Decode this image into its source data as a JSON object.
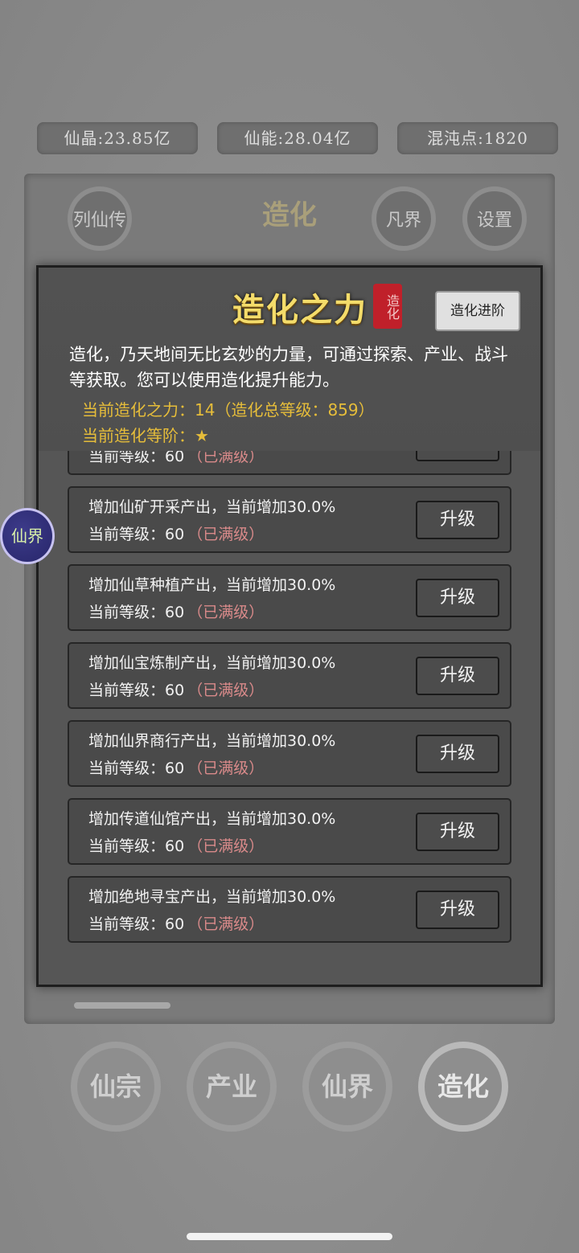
{
  "resources": [
    {
      "label": "仙晶:23.85亿"
    },
    {
      "label": "仙能:28.04亿"
    },
    {
      "label": "混沌点:1820"
    }
  ],
  "main": {
    "title": "造化",
    "left_button": "列仙传",
    "right_buttons": [
      "凡界",
      "设置"
    ]
  },
  "dialog": {
    "title": "造化之力",
    "seal_text": "造化",
    "advance_button": "造化进阶",
    "description": "造化，乃天地间无比玄妙的力量，可通过探索、产业、战斗等获取。您可以使用造化提升能力。",
    "power_line": "当前造化之力：14（造化总等级：859）",
    "tier_line": "当前造化等阶：★",
    "upgrade_label": "升级",
    "max_label": "（已满级）",
    "partial_level": "当前等级：60",
    "rows": [
      {
        "desc": "增加仙矿开采产出，当前增加30.0%",
        "level": "当前等级：60"
      },
      {
        "desc": "增加仙草种植产出，当前增加30.0%",
        "level": "当前等级：60"
      },
      {
        "desc": "增加仙宝炼制产出，当前增加30.0%",
        "level": "当前等级：60"
      },
      {
        "desc": "增加仙界商行产出，当前增加30.0%",
        "level": "当前等级：60"
      },
      {
        "desc": "增加传道仙馆产出，当前增加30.0%",
        "level": "当前等级：60"
      },
      {
        "desc": "增加绝地寻宝产出，当前增加30.0%",
        "level": "当前等级：60"
      }
    ]
  },
  "side_float": "仙界",
  "bottom_nav": [
    "仙宗",
    "产业",
    "仙界",
    "造化"
  ],
  "colors": {
    "accent_gold": "#e6bd3a",
    "max_level_red": "#d98a8a",
    "title_gold": "#f4dc6a"
  }
}
